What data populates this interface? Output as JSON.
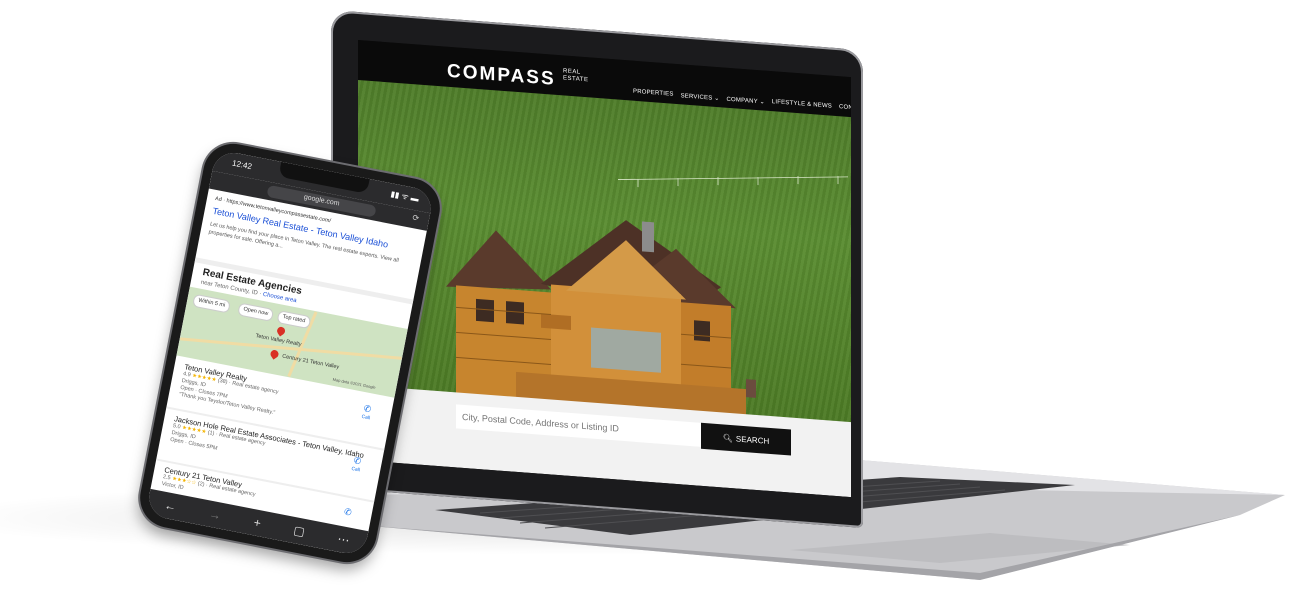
{
  "laptop": {
    "brand": "COMPASS",
    "brand_sub": "REAL ESTATE",
    "nav": [
      "PROPERTIES",
      "SERVICES ⌄",
      "COMPANY ⌄",
      "LIFESTYLE & NEWS",
      "CONTACT"
    ],
    "search": {
      "placeholder": "City, Postal Code, Address or Listing ID",
      "button_label": "SEARCH",
      "button_icon": "search-icon"
    }
  },
  "phone": {
    "status_time": "12:42",
    "status_icons": "▮▮ ᯤ ▬",
    "url": "google.com",
    "ad_label": "Ad · https://www.tetonvalleycompassestate.com/",
    "ad_title": "Teton Valley Real Estate - Teton Valley Idaho",
    "ad_desc": "Let us help you find your place in Teton Valley. The real estate experts. View all properties for sale. Offering a...",
    "section_title": "Real Estate Agencies",
    "section_sub": "near Teton County, ID · ",
    "section_sub_link": "Choose area",
    "map_chips": [
      "Within 5 mi",
      "Open now",
      "Top rated"
    ],
    "map_pins": [
      "Teton Valley Realty",
      "Century 21 Teton Valley"
    ],
    "map_credit": "Map data ©2021 Google",
    "listings": [
      {
        "name": "Teton Valley Realty",
        "rating": "4.9",
        "stars": "★★★★★",
        "count": "(38)",
        "type": "· Real estate agency",
        "city": "Driggs, ID",
        "hours": "Open · Closes 7PM",
        "quote": "\"Thank you Teyslor/Teton Valley Realty.\"",
        "call": "Call"
      },
      {
        "name": "Jackson Hole Real Estate Associates - Teton Valley, Idaho",
        "rating": "5.0",
        "stars": "★★★★★",
        "count": "(1)",
        "type": "· Real estate agency",
        "city": "Driggs, ID",
        "hours": "Open · Closes 5PM",
        "quote": "",
        "call": "Call"
      },
      {
        "name": "Century 21 Teton Valley",
        "rating": "2.5",
        "stars": "★★★☆☆",
        "count": "(2)",
        "type": "· Real estate agency",
        "city": "Victor, ID",
        "hours": "",
        "quote": "",
        "call": ""
      }
    ],
    "bottom_icons": [
      "←",
      "→",
      "+",
      "▢",
      "⋯"
    ]
  }
}
